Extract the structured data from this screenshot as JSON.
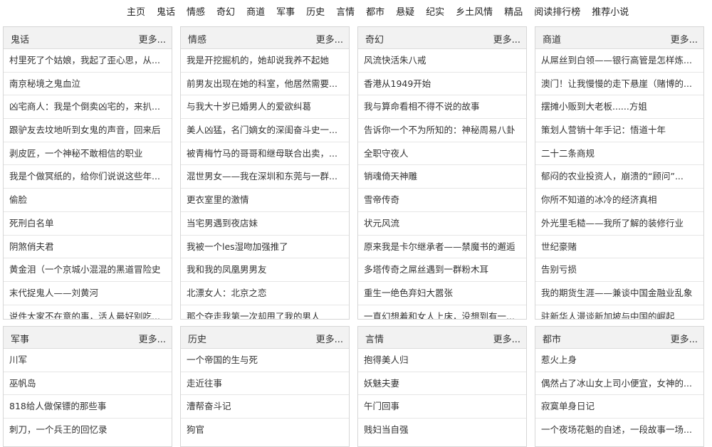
{
  "nav": [
    "主页",
    "鬼话",
    "情感",
    "奇幻",
    "商道",
    "军事",
    "历史",
    "言情",
    "都市",
    "悬疑",
    "纪实",
    "乡土风情",
    "精品",
    "阅读排行榜",
    "推荐小说"
  ],
  "more_label": "更多...",
  "panels": [
    {
      "title": "鬼话",
      "items": [
        "村里死了个姑娘，我起了歪心思，从...",
        "南京秘境之鬼血泣",
        "凶宅商人：我是个倒卖凶宅的，来扒...",
        "跟驴友去坟地听到女鬼的声音，回来后",
        "剥皮匠，一个神秘不敢相信的职业",
        "我是个做冥纸的，给你们说说这些年...",
        "偷脸",
        "死刑白名单",
        "阴煞俏夫君",
        "黄金泪（一个京城小混混的黑道冒险史",
        "末代捉鬼人——刘黄河",
        "说件大家不在意的事，活人最好别吃..."
      ]
    },
    {
      "title": "情感",
      "items": [
        "我是开挖掘机的，她却说我养不起她",
        "前男友出现在她的科室，他居然需要...",
        "与我大十岁已婚男人的爱欲纠葛",
        "美人凶猛，名门嫡女的深闺奋斗史一...",
        "被青梅竹马的哥哥和继母联合出卖，...",
        "混世男女——我在深圳和东莞与一群...",
        "更衣室里的激情",
        "当宅男遇到夜店妹",
        "我被一个les湿吻加强推了",
        "我和我的凤凰男男友",
        "北漂女人：北京之恋",
        "那个夺走我第一次却甩了我的男人"
      ]
    },
    {
      "title": "奇幻",
      "items": [
        "风流快活朱八戒",
        "香港从1949开始",
        "我与算命看相不得不说的故事",
        "告诉你一个不为所知的：神秘周易八卦",
        "全职守夜人",
        "销魂倚天神雕",
        "雪帝传奇",
        "状元风流",
        "原来我是卡尔继承者——禁魔书的邂逅",
        "多塔传奇之屌丝遇到一群粉木耳",
        "重生一绝色弃妇大嚣张",
        "一直幻想着和女人上床，没想到有一..."
      ]
    },
    {
      "title": "商道",
      "items": [
        "从屌丝到白领——银行高管是怎样炼...",
        "澳门！让我慢慢的走下悬崖（赌博的...",
        "摆摊小贩到大老板......方姐",
        "策划人营销十年手记：悟道十年",
        "二十二条商规",
        "郁闷的农业投资人，崩溃的“顾问”...",
        "你所不知道的冰冷的经济真相",
        "外光里毛糙——我所了解的装修行业",
        "世纪豪赌",
        "告别亏损",
        "我的期货生涯——兼谈中国金融业乱象",
        "驻新华人漫谈新加坡与中国的崛起"
      ]
    },
    {
      "title": "军事",
      "items": [
        "川军",
        "巫帆岛",
        "818给人做保镖的那些事",
        "刺刀，一个兵王的回忆录"
      ]
    },
    {
      "title": "历史",
      "items": [
        "一个帝国的生与死",
        "走近往事",
        "漕帮奋斗记",
        "狗官"
      ]
    },
    {
      "title": "言情",
      "items": [
        "抱得美人归",
        "妖魅夫妻",
        "午门回事",
        "贱妇当自强"
      ]
    },
    {
      "title": "都市",
      "items": [
        "惹火上身",
        "偶然占了冰山女上司小便宜，女神的...",
        "寂寞单身日记",
        "一个夜场花魁的自述，一段故事一场..."
      ]
    }
  ]
}
